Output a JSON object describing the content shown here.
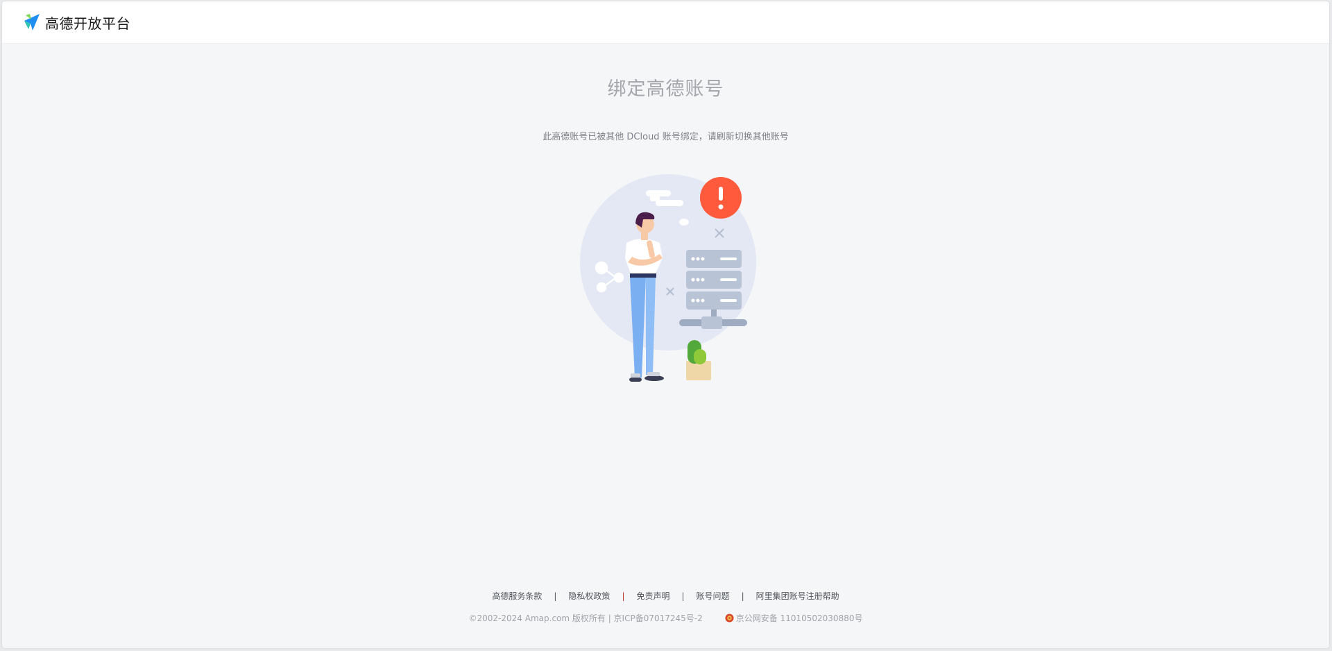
{
  "header": {
    "logo_text": "高德开放平台"
  },
  "main": {
    "title": "绑定高德账号",
    "message": "此高德账号已被其他 DCloud 账号绑定，请刷新切换其他账号",
    "illustration_icon": "person-server-error-illustration"
  },
  "footer": {
    "links": [
      {
        "label": "高德服务条款"
      },
      {
        "label": "隐私权政策"
      },
      {
        "label": "免责声明"
      },
      {
        "label": "账号问题"
      },
      {
        "label": "阿里集团账号注册帮助"
      }
    ],
    "separator": "|",
    "copyright": "©2002-2024 Amap.com 版权所有 | 京ICP备07017245号-2",
    "police_record": "京公网安备 11010502030880号"
  },
  "colors": {
    "background": "#f5f6f8",
    "header": "#ffffff",
    "alert": "#ff5a3c",
    "circle": "#e3e8f4",
    "server": "#b8c3d6",
    "jeans": "#7ab0f2"
  }
}
